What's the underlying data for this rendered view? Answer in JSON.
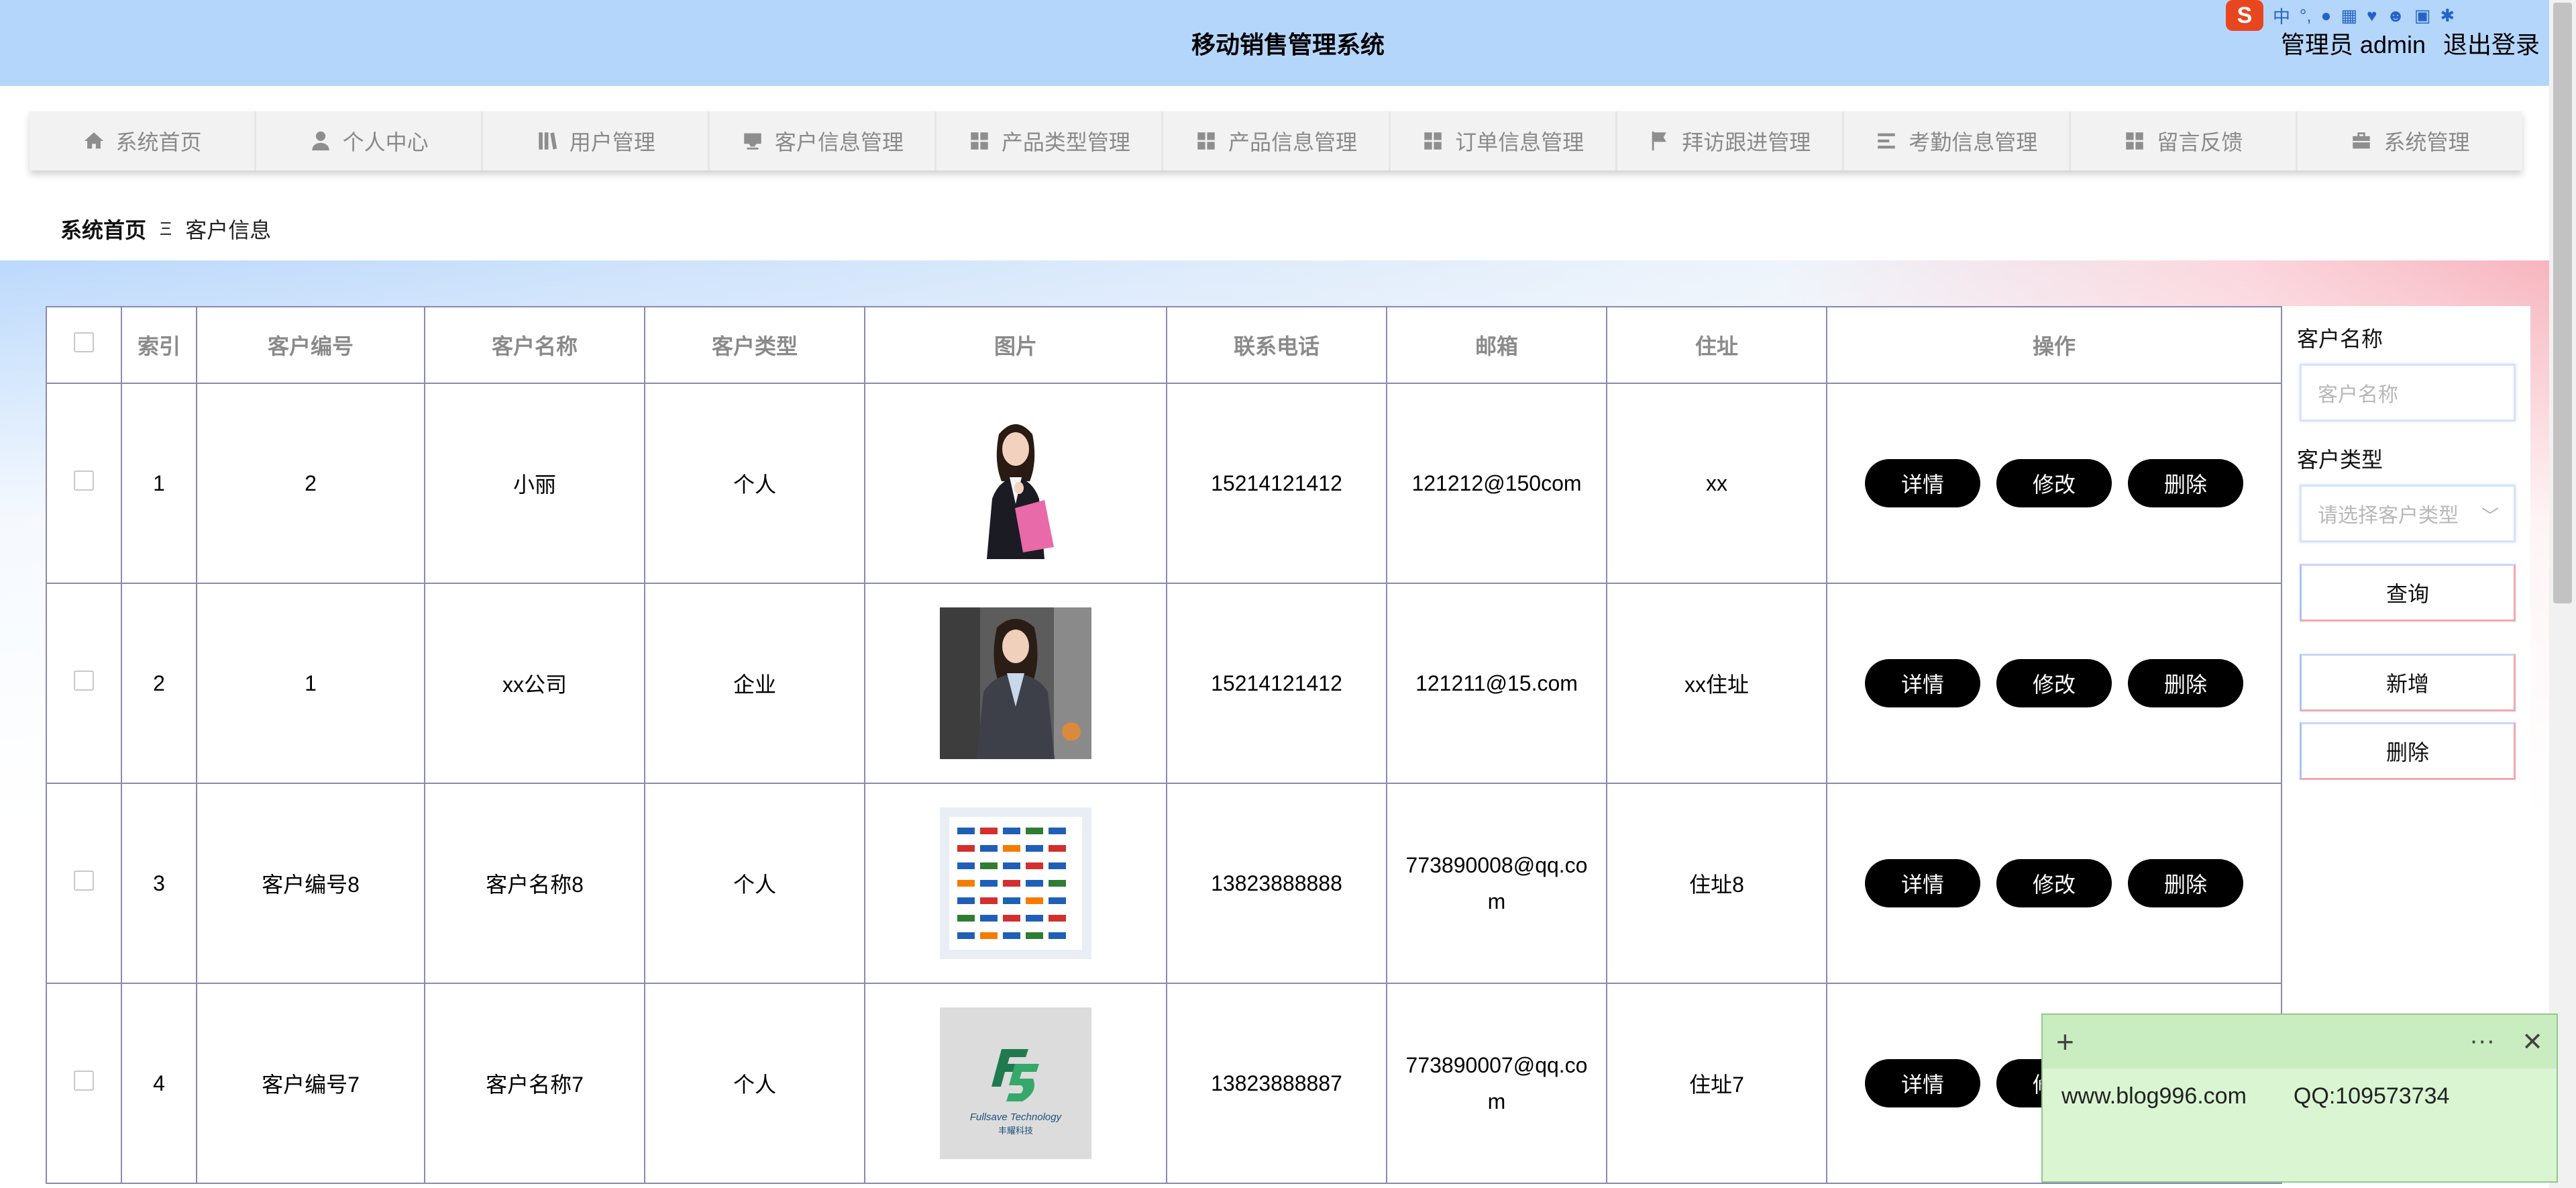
{
  "header": {
    "title": "移动销售管理系统",
    "user_label": "管理员 admin",
    "logout": "退出登录",
    "ime_logo": "S",
    "ime_mode": "中"
  },
  "nav": {
    "items": [
      {
        "label": "系统首页",
        "icon": "home-icon"
      },
      {
        "label": "个人中心",
        "icon": "user-icon"
      },
      {
        "label": "用户管理",
        "icon": "library-icon"
      },
      {
        "label": "客户信息管理",
        "icon": "inbox-icon"
      },
      {
        "label": "产品类型管理",
        "icon": "grid-icon"
      },
      {
        "label": "产品信息管理",
        "icon": "grid-icon"
      },
      {
        "label": "订单信息管理",
        "icon": "grid-icon"
      },
      {
        "label": "拜访跟进管理",
        "icon": "flag-icon"
      },
      {
        "label": "考勤信息管理",
        "icon": "list-icon"
      },
      {
        "label": "留言反馈",
        "icon": "grid-icon"
      },
      {
        "label": "系统管理",
        "icon": "briefcase-icon"
      }
    ]
  },
  "breadcrumb": {
    "home": "系统首页",
    "separator": "Ξ",
    "current": "客户信息"
  },
  "table": {
    "headers": [
      "索引",
      "客户编号",
      "客户名称",
      "客户类型",
      "图片",
      "联系电话",
      "邮箱",
      "住址",
      "操作"
    ],
    "rows": [
      {
        "index": "1",
        "code": "2",
        "name": "小丽",
        "type": "个人",
        "image": "woman-with-folder-photo",
        "phone": "15214121412",
        "email": "121212@150com",
        "address": "xx"
      },
      {
        "index": "2",
        "code": "1",
        "name": "xx公司",
        "type": "企业",
        "image": "businesswoman-photo",
        "phone": "15214121412",
        "email": "121211@15.com",
        "address": "xx住址"
      },
      {
        "index": "3",
        "code": "客户编号8",
        "name": "客户名称8",
        "type": "个人",
        "image": "logo-wall-photo",
        "phone": "13823888888",
        "email": "773890008@qq.com",
        "address": "住址8"
      },
      {
        "index": "4",
        "code": "客户编号7",
        "name": "客户名称7",
        "type": "个人",
        "image": "fullsave-logo-photo",
        "phone": "13823888887",
        "email": "773890007@qq.com",
        "address": "住址7"
      }
    ],
    "actions": {
      "detail": "详情",
      "edit": "修改",
      "delete": "删除"
    }
  },
  "search": {
    "name_label": "客户名称",
    "name_placeholder": "客户名称",
    "type_label": "客户类型",
    "type_placeholder": "请选择客户类型",
    "query_button": "查询",
    "add_button": "新增",
    "delete_button": "删除"
  },
  "note": {
    "site": "www.blog996.com",
    "qq": "QQ:109573734"
  },
  "logo_text": {
    "brand": "Fullsave Technology",
    "brand_cn": "丰耀科技"
  },
  "colors": {
    "header_bg": "#b5d6fb",
    "table_border": "#8b88b2",
    "action_button": "#000000",
    "note_bg": "#d9f5d2"
  }
}
